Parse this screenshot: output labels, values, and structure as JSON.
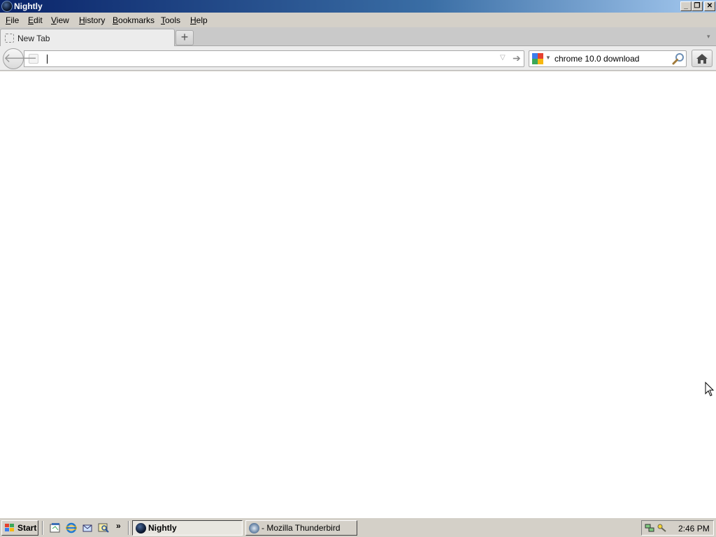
{
  "window": {
    "title": "Nightly",
    "controls": {
      "minimize": "_",
      "maximize": "❐",
      "close": "✕"
    }
  },
  "menubar": {
    "items": [
      {
        "label": "File"
      },
      {
        "label": "Edit"
      },
      {
        "label": "View"
      },
      {
        "label": "History"
      },
      {
        "label": "Bookmarks"
      },
      {
        "label": "Tools"
      },
      {
        "label": "Help"
      }
    ]
  },
  "tabs": {
    "items": [
      {
        "label": "New Tab",
        "active": true
      }
    ],
    "new_tab_symbol": "+"
  },
  "navbar": {
    "url": {
      "value": "",
      "placeholder": ""
    },
    "search": {
      "engine": "google-icon",
      "value": "chrome 10.0 download"
    }
  },
  "taskbar": {
    "start_label": "Start",
    "more_symbol": "»",
    "quick_launch": [
      "show-desktop-icon",
      "internet-explorer-icon",
      "outlook-express-icon",
      "search-icon"
    ],
    "tasks": [
      {
        "label": "Nightly",
        "active": true
      },
      {
        "label": "- Mozilla Thunderbird",
        "active": false
      }
    ],
    "tray": {
      "clock": "2:46 PM",
      "icons": [
        "network-icon",
        "security-key-icon"
      ]
    }
  },
  "colors": {
    "titlebar_start": "#0a246a",
    "titlebar_end": "#a6caf0",
    "chrome_gray": "#d4d0c8",
    "content_bg": "#ffffff"
  }
}
